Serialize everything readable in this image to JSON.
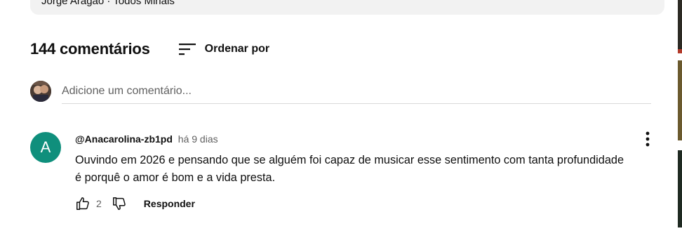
{
  "description": {
    "text": "Jorge Aragão · Todos Minais"
  },
  "comments_header": {
    "count_label": "144 comentários",
    "sort_label": "Ordenar por",
    "sort_icon": "sort-icon"
  },
  "add_comment": {
    "placeholder": "Adicione um comentário..."
  },
  "comment": {
    "avatar_letter": "A",
    "avatar_color": "#0f8f7c",
    "author": "@Anacarolina-zb1pd",
    "time": "há 9 dias",
    "text": "Ouvindo em 2026 e pensando que se alguém foi capaz de musicar esse sentimento com tanta profundidade\né porquê o amor é bom e a vida presta.",
    "likes": "2",
    "reply_label": "Responder"
  },
  "colors": {
    "accent_teal": "#0f8f7c",
    "secondary_text": "#606060",
    "divider": "#d9d9d9"
  }
}
